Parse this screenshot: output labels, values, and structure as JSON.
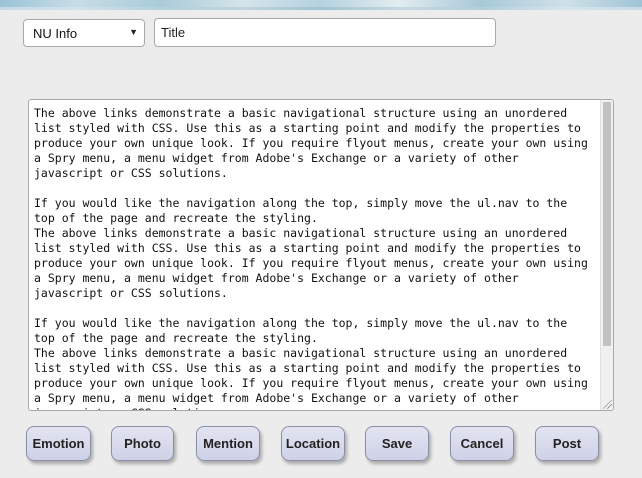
{
  "form": {
    "category_select": {
      "value": "NU Info"
    },
    "title_input": {
      "value": "Title"
    },
    "body_textarea": {
      "value": "The above links demonstrate a basic navigational structure using an unordered\nlist styled with CSS. Use this as a starting point and modify the properties to\nproduce your own unique look. If you require flyout menus, create your own using\na Spry menu, a menu widget from Adobe's Exchange or a variety of other\njavascript or CSS solutions.\n\nIf you would like the navigation along the top, simply move the ul.nav to the\ntop of the page and recreate the styling.\nThe above links demonstrate a basic navigational structure using an unordered\nlist styled with CSS. Use this as a starting point and modify the properties to\nproduce your own unique look. If you require flyout menus, create your own using\na Spry menu, a menu widget from Adobe's Exchange or a variety of other\njavascript or CSS solutions.\n\nIf you would like the navigation along the top, simply move the ul.nav to the\ntop of the page and recreate the styling.\nThe above links demonstrate a basic navigational structure using an unordered\nlist styled with CSS. Use this as a starting point and modify the properties to\nproduce your own unique look. If you require flyout menus, create your own using\na Spry menu, a menu widget from Adobe's Exchange or a variety of other\njavascript or CSS solutions."
    }
  },
  "actions": {
    "emotion": "Emotion",
    "photo": "Photo",
    "mention": "Mention",
    "location": "Location",
    "save": "Save",
    "cancel": "Cancel",
    "post": "Post"
  },
  "colors": {
    "button_background": "#d8daec",
    "button_border": "#8a8fa8",
    "page_background": "#ececec"
  }
}
